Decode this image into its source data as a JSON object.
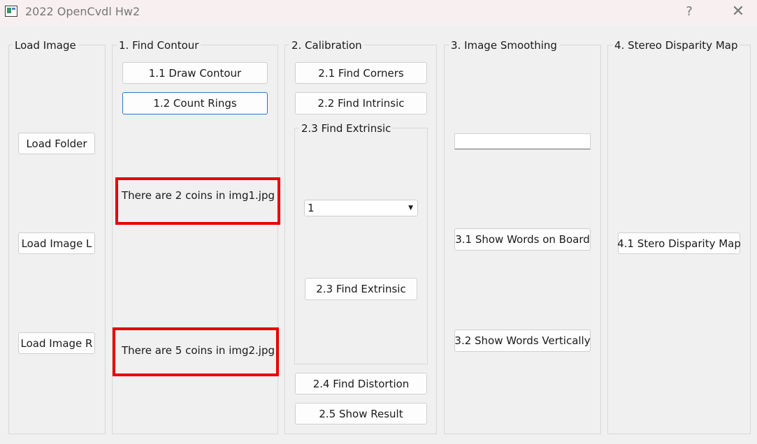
{
  "window": {
    "title": "2022 OpenCvdl Hw2",
    "help_label": "?",
    "close_label": "✕"
  },
  "load_image": {
    "title": "Load Image",
    "load_folder": "Load Folder",
    "load_image_l": "Load Image L",
    "load_image_r": "Load Image R"
  },
  "find_contour": {
    "title": "1. Find Contour",
    "draw_contour": "1.1 Draw Contour",
    "count_rings": "1.2 Count Rings",
    "result_1": "There are 2 coins in img1.jpg",
    "result_2": "There are 5 coins in img2.jpg"
  },
  "calibration": {
    "title": "2. Calibration",
    "find_corners": "2.1 Find Corners",
    "find_intrinsic": "2.2 Find Intrinsic",
    "extrinsic_group_title": "2.3 Find Extrinsic",
    "extrinsic_selected": "1",
    "find_extrinsic": "2.3 Find Extrinsic",
    "find_distortion": "2.4 Find Distortion",
    "show_result": "2.5 Show Result"
  },
  "image_smoothing": {
    "title": "3. Image Smoothing",
    "words_input_value": "",
    "show_words_on_board": "3.1 Show Words on Board",
    "show_words_vertically": "3.2 Show Words Vertically"
  },
  "stereo": {
    "title": "4. Stereo Disparity Map",
    "stereo_disparity_map": "4.1 Stero Disparity Map"
  },
  "highlight_color": "#e80000",
  "focus_color": "#2a78c8"
}
